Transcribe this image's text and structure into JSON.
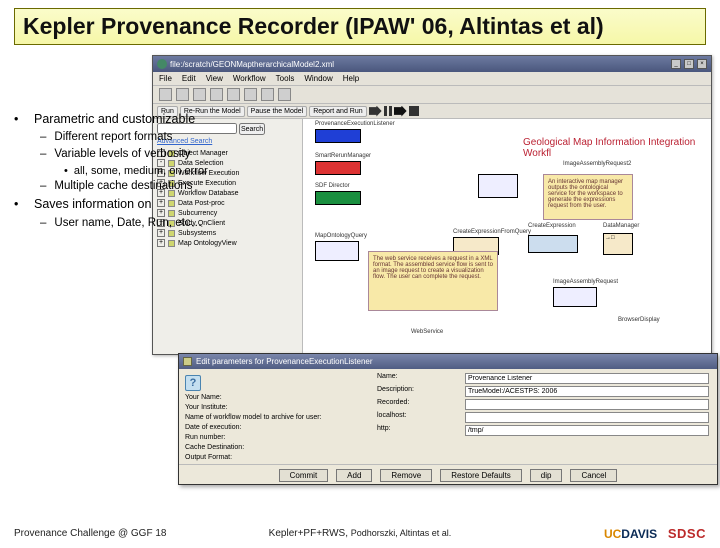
{
  "title": {
    "main": "Kepler Provenance Recorder",
    "paren": "(IPAW' 06, Altintas et al)"
  },
  "bullets": {
    "p1": "Parametric and customizable",
    "p1a": "Different report formats",
    "p1b": "Variable levels of verbosity",
    "p1b1": "all, some, medium, on error",
    "p1c": "Multiple cache destinations",
    "p2": "Saves information on",
    "p2a": "User name, Date, Run, etc…"
  },
  "appwin": {
    "title": "file:/scratch/GEONMaptherarchicalModel2.xml",
    "menu": [
      "File",
      "Edit",
      "View",
      "Workflow",
      "Tools",
      "Window",
      "Help"
    ],
    "top2": {
      "run": "Run",
      "rerun": "Re-Run the Model",
      "pause": "Pause the Model",
      "report": "Report and Run"
    }
  },
  "tree": {
    "search_label": "Search",
    "advanced": "Advanced Search",
    "items": [
      "Object Manager",
      "Data Selection",
      "Workflow Execution",
      "Execute Execution",
      "Workflow Database",
      "Data Post-proc",
      "Subcurrency",
      "Study QnClient",
      "Subsystems",
      "Map OntologyView"
    ]
  },
  "workflow": {
    "title": "Geological Map Information Integration Workfl",
    "actors": {
      "prov": "ProvenanceExecutionListener",
      "smart": "SmartRerunManager",
      "sdf": "SDF Director",
      "map": "MapOntologyQuery",
      "svg": "ImageAssemblyRequest",
      "svg2": "ImageAssemblyRequest2",
      "dm": "DataManager",
      "gf": "CreateExpressionFromQuery",
      "ce": "CreateExpression",
      "ws": "WebService",
      "bb": "BrowserDisplay"
    },
    "note1": "An interactive map manager outputs the ontological service for the workspace to generate the expressions request from the user.",
    "note2": "The web service receives a request in a XML format. The assembled service flow is sent to an image request to create a visualization flow. The user can complete the request."
  },
  "dialog": {
    "title": "Edit parameters for ProvenanceExecutionListener",
    "left": {
      "l1": "Your Name:",
      "l2": "Your Institute:",
      "l3": "Name of workflow model to archive for user:",
      "l4": "Date of execution:",
      "l5": "Run number:",
      "l6": "Cache Destination:",
      "l7": "Output Format:"
    },
    "right": {
      "k1": "Name:",
      "v1": "Provenance Listener",
      "k2": "Description:",
      "v2": "TrueModel:/ACESTPS: 2006",
      "k3": "Recorded:",
      "v3": "",
      "k4": "localhost:",
      "v4": "",
      "k5": "http:",
      "v5": "/tmp/"
    },
    "buttons": [
      "Commit",
      "Add",
      "Remove",
      "Restore Defaults",
      "dip",
      "Cancel"
    ]
  },
  "footer": {
    "left": "Provenance Challenge @ GGF 18",
    "mid_a": "Kepler+PF+RWS,",
    "mid_b": "Podhorszki, Altintas et al.",
    "ucd": "UCDAVIS",
    "sdsc": "SDSC"
  }
}
